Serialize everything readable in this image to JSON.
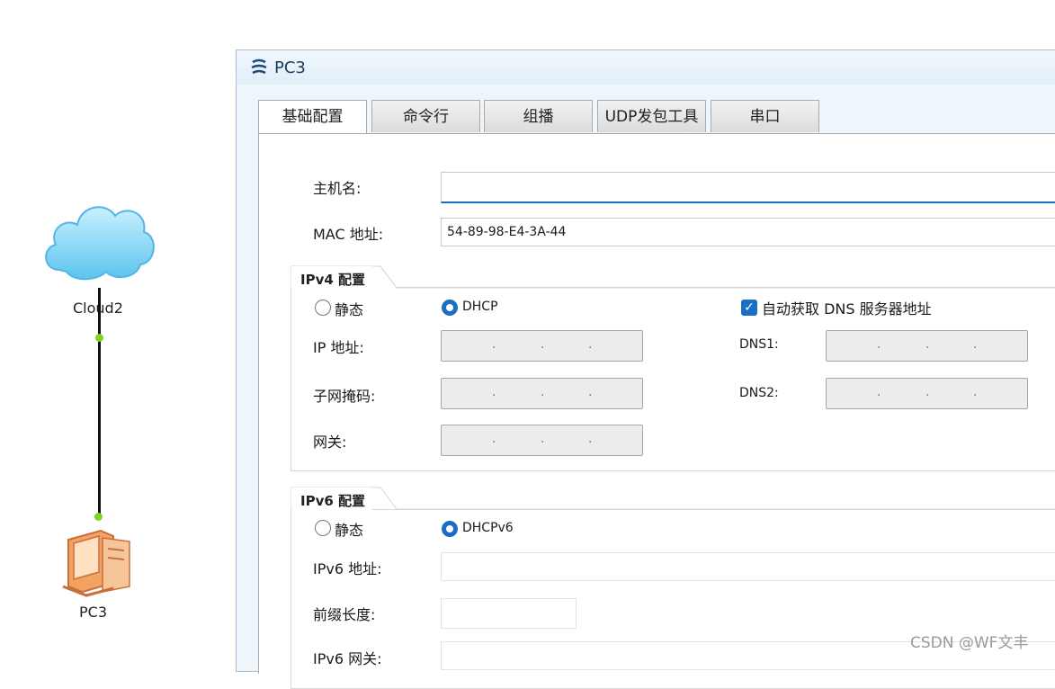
{
  "topology": {
    "cloud_label": "Cloud2",
    "pc_label": "PC3"
  },
  "window": {
    "title": "PC3",
    "tabs": [
      {
        "label": "基础配置",
        "active": true
      },
      {
        "label": "命令行",
        "active": false
      },
      {
        "label": "组播",
        "active": false
      },
      {
        "label": "UDP发包工具",
        "active": false
      },
      {
        "label": "串口",
        "active": false
      }
    ]
  },
  "basic": {
    "hostname_label": "主机名:",
    "hostname_value": "",
    "mac_label": "MAC 地址:",
    "mac_value": "54-89-98-E4-3A-44"
  },
  "ipv4": {
    "group_title": "IPv4 配置",
    "static_label": "静态",
    "dhcp_label": "DHCP",
    "mode": "DHCP",
    "auto_dns_label": "自动获取 DNS 服务器地址",
    "auto_dns_checked": true,
    "ip_label": "IP 地址:",
    "mask_label": "子网掩码:",
    "gateway_label": "网关:",
    "dns1_label": "DNS1:",
    "dns2_label": "DNS2:"
  },
  "ipv6": {
    "group_title": "IPv6 配置",
    "static_label": "静态",
    "dhcp_label": "DHCPv6",
    "mode": "DHCPv6",
    "ip_label": "IPv6 地址:",
    "prefix_label": "前缀长度:",
    "gateway_label": "IPv6 网关:"
  },
  "watermark": "CSDN @WF文丰",
  "colors": {
    "accent": "#1a6fc4",
    "port_dot": "#7ed321",
    "cloud": "#7fd3f5"
  }
}
